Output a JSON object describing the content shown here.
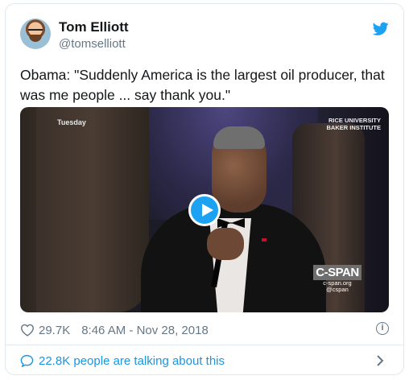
{
  "tweet": {
    "author_name": "Tom Elliott",
    "author_handle": "@tomselliott",
    "text": "Obama: \"Suddenly America is the largest oil producer, that was me people ... say thank you.\"",
    "media": {
      "video_tag": "Tuesday",
      "watermark_line1": "RICE UNIVERSITY",
      "watermark_line2": "BAKER INSTITUTE",
      "network_logo": "C-SPAN",
      "network_url": "c-span.org",
      "network_handle": "@cspan"
    },
    "likes": "29.7K",
    "timestamp": "8:46 AM - Nov 28, 2018",
    "talking": "22.8K people are talking about this"
  },
  "icons": {
    "brand": "twitter-bird-icon",
    "like": "heart-icon",
    "info": "info-icon",
    "conversation": "speech-bubble-icon",
    "more": "chevron-right-icon"
  },
  "colors": {
    "accent": "#1da1f2",
    "link": "#1b95e0",
    "muted": "#657786",
    "text": "#14171a"
  }
}
